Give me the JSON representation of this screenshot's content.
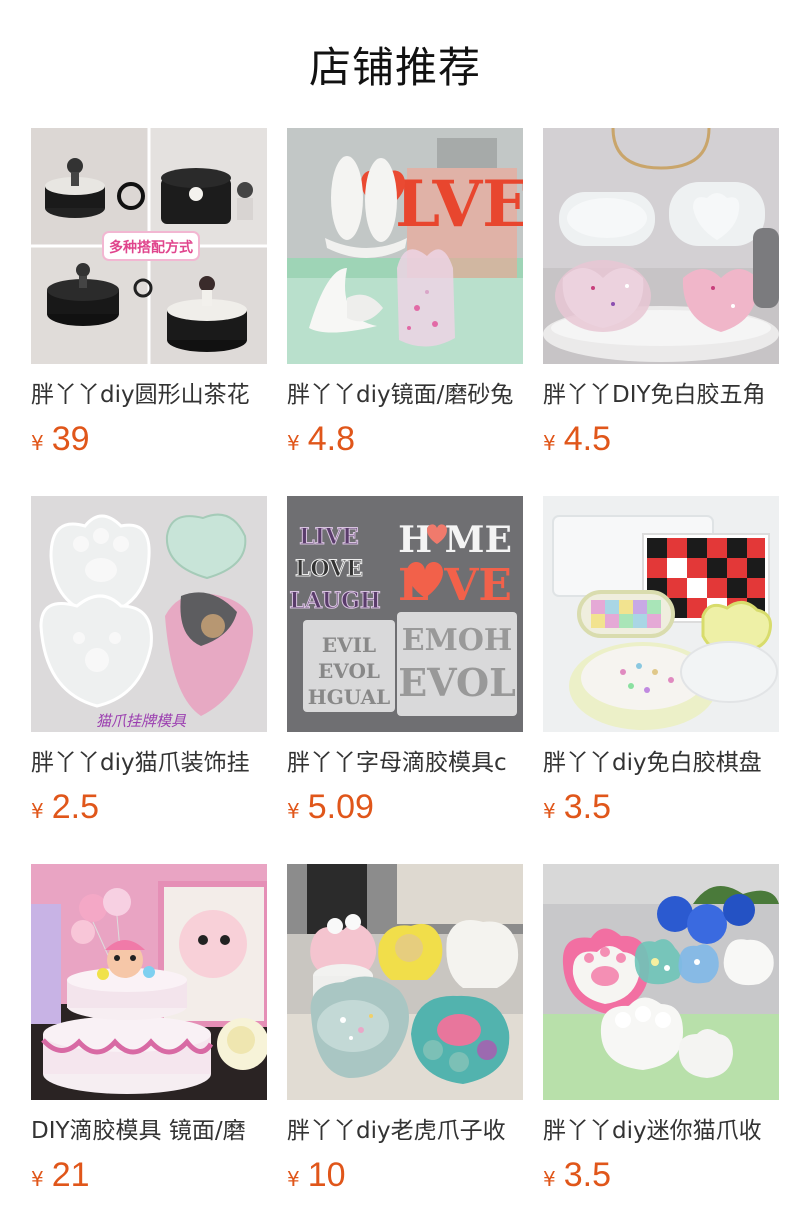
{
  "header": {
    "title": "店铺推荐"
  },
  "products": [
    {
      "title": "胖丫丫diy圆形山茶花",
      "currency": "¥",
      "price": "39",
      "image_badge": "多种搭配方式"
    },
    {
      "title": "胖丫丫diy镜面/磨砂兔",
      "currency": "¥",
      "price": "4.8"
    },
    {
      "title": "胖丫丫DIY免白胶五角",
      "currency": "¥",
      "price": "4.5"
    },
    {
      "title": "胖丫丫diy猫爪装饰挂",
      "currency": "¥",
      "price": "2.5",
      "image_caption": "猫爪挂牌模具"
    },
    {
      "title": "胖丫丫字母滴胶模具c",
      "currency": "¥",
      "price": "5.09"
    },
    {
      "title": "胖丫丫diy免白胶棋盘",
      "currency": "¥",
      "price": "3.5"
    },
    {
      "title": "DIY滴胶模具 镜面/磨",
      "currency": "¥",
      "price": "21"
    },
    {
      "title": "胖丫丫diy老虎爪子收",
      "currency": "¥",
      "price": "10"
    },
    {
      "title": "胖丫丫diy迷你猫爪收",
      "currency": "¥",
      "price": "3.5"
    }
  ]
}
